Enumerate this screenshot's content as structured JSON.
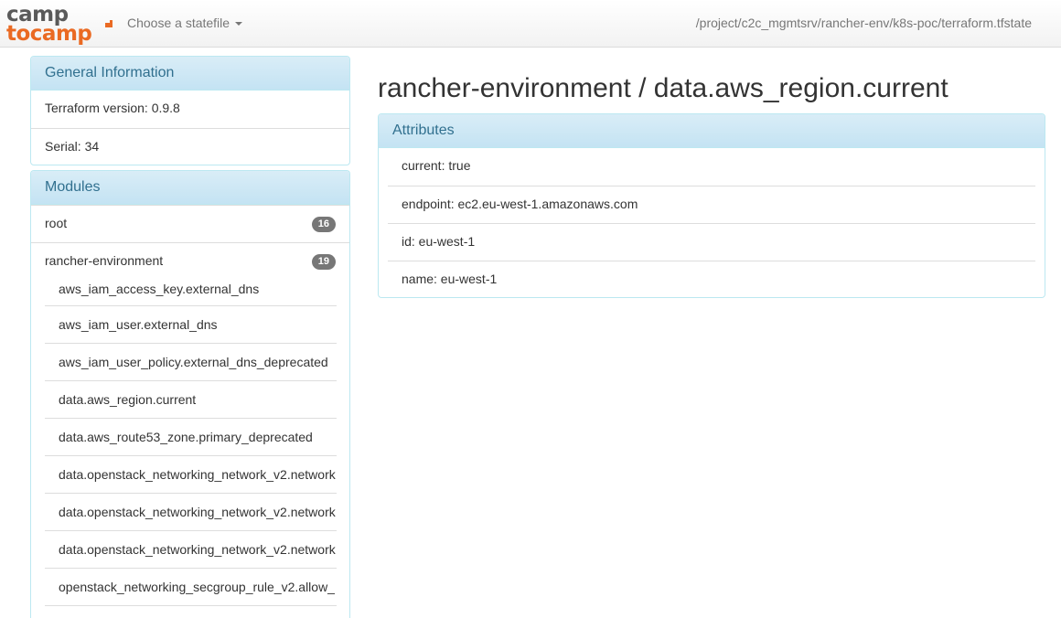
{
  "logo": {
    "line1": "camp",
    "line2": "tocamp"
  },
  "nav": {
    "statefile_label": "Choose a statefile",
    "path": "/project/c2c_mgmtsrv/rancher-env/k8s-poc/terraform.tfstate"
  },
  "general": {
    "title": "General Information",
    "terraform_version": "Terraform version: 0.9.8",
    "serial": "Serial: 34"
  },
  "modules": {
    "title": "Modules",
    "items": [
      {
        "label": "root",
        "count": "16"
      },
      {
        "label": "rancher-environment",
        "count": "19"
      }
    ],
    "resources": [
      "aws_iam_access_key.external_dns",
      "aws_iam_user.external_dns",
      "aws_iam_user_policy.external_dns_deprecated",
      "data.aws_region.current",
      "data.aws_route53_zone.primary_deprecated",
      "data.openstack_networking_network_v2.network",
      "data.openstack_networking_network_v2.network",
      "data.openstack_networking_network_v2.network",
      "openstack_networking_secgroup_rule_v2.allow_"
    ]
  },
  "main": {
    "title": "rancher-environment / data.aws_region.current",
    "attributes_title": "Attributes",
    "attributes": [
      "current: true",
      "endpoint: ec2.eu-west-1.amazonaws.com",
      "id: eu-west-1",
      "name: eu-west-1"
    ]
  },
  "colors": {
    "brand_orange": "#ea6a23",
    "panel_heading": "#31708f",
    "panel_border": "#bce8f1"
  }
}
